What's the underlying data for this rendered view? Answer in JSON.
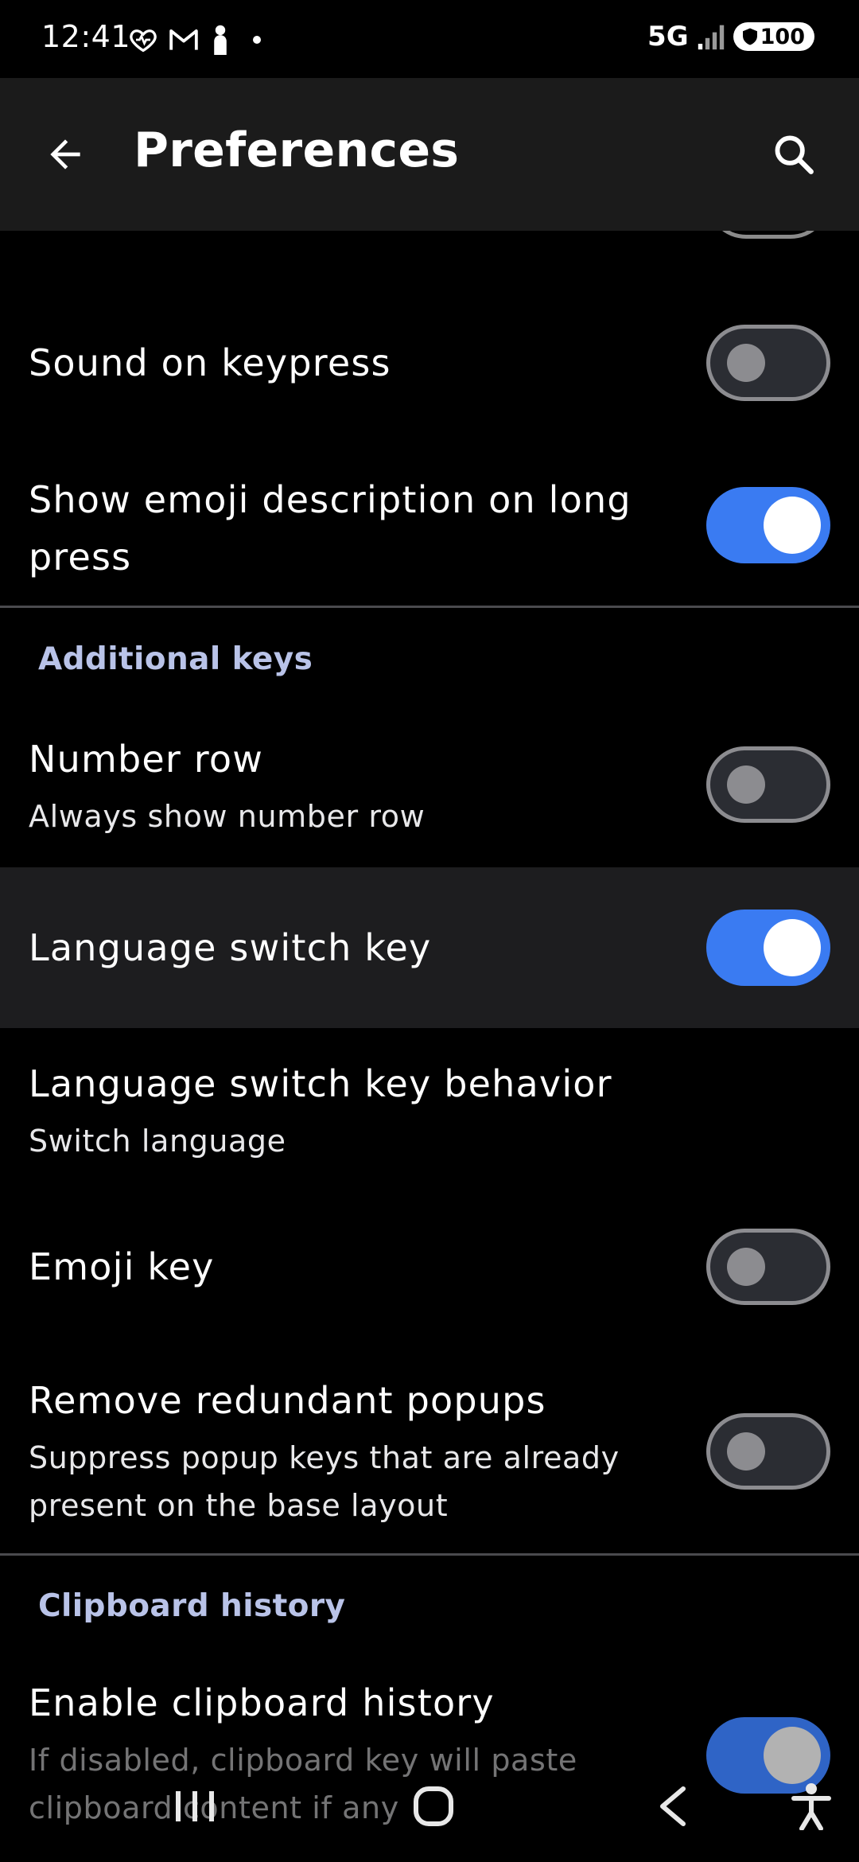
{
  "status_bar": {
    "time": "12:41",
    "network": "5G",
    "battery": "100"
  },
  "app_bar": {
    "title": "Preferences"
  },
  "settings": {
    "sound_on_keypress": {
      "title": "Sound on keypress",
      "enabled": false
    },
    "show_emoji_description": {
      "title": "Show emoji description on long press",
      "enabled": true
    },
    "additional_keys_header": "Additional keys",
    "number_row": {
      "title": "Number row",
      "summary": "Always show number row",
      "enabled": false
    },
    "language_switch_key": {
      "title": "Language switch key",
      "enabled": true
    },
    "language_switch_key_behavior": {
      "title": "Language switch key behavior",
      "summary": "Switch language"
    },
    "emoji_key": {
      "title": "Emoji key",
      "enabled": false
    },
    "remove_redundant_popups": {
      "title": "Remove redundant popups",
      "summary": "Suppress popup keys that are already present on the base layout",
      "enabled": false
    },
    "clipboard_history_header": "Clipboard history",
    "enable_clipboard_history": {
      "title": "Enable clipboard history",
      "summary": "If disabled, clipboard key will paste clipboard content if any",
      "enabled": true
    }
  },
  "colors": {
    "background": "#000000",
    "app_bar": "#1b1b1b",
    "accent": "#3a7bf2",
    "section_header": "#b9c3e8"
  },
  "nav_bar": {
    "icons": [
      "recents-icon",
      "home-icon",
      "back-icon",
      "accessibility-icon"
    ]
  }
}
